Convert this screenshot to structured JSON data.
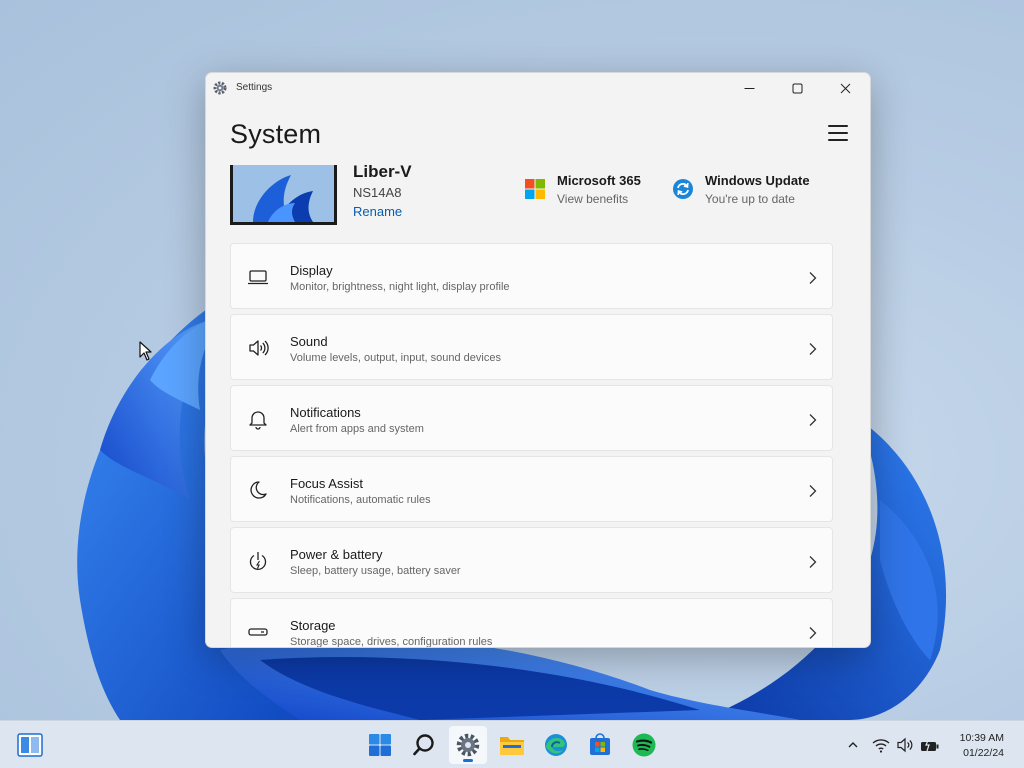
{
  "window": {
    "title": "Settings",
    "page_title": "System"
  },
  "device": {
    "name": "Liber-V",
    "model": "NS14A8",
    "rename_label": "Rename"
  },
  "quick_links": [
    {
      "title": "Microsoft 365",
      "subtitle": "View benefits",
      "icon": "microsoft-logo-icon"
    },
    {
      "title": "Windows Update",
      "subtitle": "You're up to date",
      "icon": "sync-icon"
    }
  ],
  "settings_items": [
    {
      "title": "Display",
      "subtitle": "Monitor, brightness, night light, display profile",
      "icon": "laptop-icon"
    },
    {
      "title": "Sound",
      "subtitle": "Volume levels, output, input, sound devices",
      "icon": "speaker-icon"
    },
    {
      "title": "Notifications",
      "subtitle": "Alert from apps and system",
      "icon": "bell-icon"
    },
    {
      "title": "Focus Assist",
      "subtitle": "Notifications, automatic rules",
      "icon": "moon-icon"
    },
    {
      "title": "Power & battery",
      "subtitle": "Sleep, battery usage, battery saver",
      "icon": "power-icon"
    },
    {
      "title": "Storage",
      "subtitle": "Storage space, drives, configuration rules",
      "icon": "drive-icon"
    }
  ],
  "taskbar": {
    "apps": [
      "start-icon",
      "search-icon",
      "settings-icon",
      "file-explorer-icon",
      "edge-icon",
      "store-icon",
      "spotify-icon"
    ],
    "active_app": "settings-icon"
  },
  "clock": {
    "time": "10:39 AM",
    "date": "01/22/24"
  },
  "colors": {
    "accent": "#0067c0",
    "link": "#0b5cad"
  }
}
